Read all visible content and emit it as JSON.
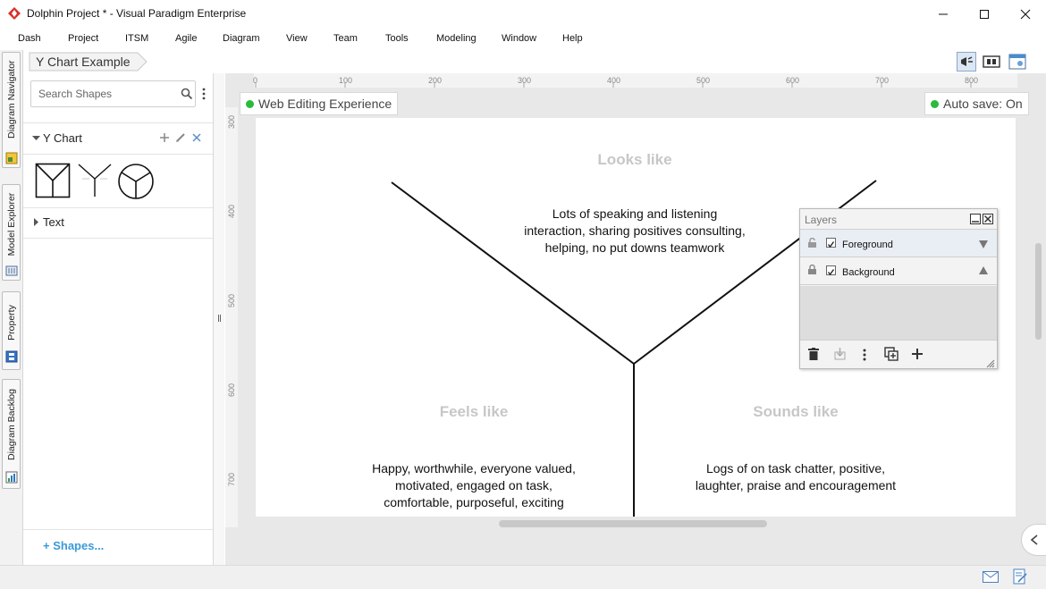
{
  "window": {
    "title": "Dolphin Project * - Visual Paradigm Enterprise",
    "icons": [
      "app-logo-icon",
      "minimize-icon",
      "maximize-icon",
      "close-icon"
    ]
  },
  "menu": [
    "Dash",
    "Project",
    "ITSM",
    "Agile",
    "Diagram",
    "View",
    "Team",
    "Tools",
    "Modeling",
    "Window",
    "Help"
  ],
  "left_tabs": [
    {
      "label": "Diagram Navigator",
      "icon": "diagram-navigator-icon"
    },
    {
      "label": "Model Explorer",
      "icon": "model-explorer-icon"
    },
    {
      "label": "Property",
      "icon": "property-icon"
    },
    {
      "label": "Diagram Backlog",
      "icon": "diagram-backlog-icon"
    }
  ],
  "breadcrumb": "Y Chart Example",
  "panel": {
    "search_placeholder": "Search Shapes",
    "group_label": "Y Chart",
    "text_group_label": "Text",
    "shapes_link": "Shapes..."
  },
  "toolbar_right_icons": [
    "announce-icon",
    "fit-diagram-icon",
    "diagram-settings-icon"
  ],
  "ruler": {
    "horizontal": [
      "0",
      "100",
      "200",
      "300",
      "400",
      "500",
      "600",
      "700",
      "800"
    ],
    "vertical": [
      "300",
      "400",
      "500",
      "600",
      "700"
    ]
  },
  "badges": {
    "web_editing": "Web Editing Experience",
    "autosave": "Auto save: On"
  },
  "diagram": {
    "looks_like": {
      "heading": "Looks like",
      "lines": [
        "Lots of speaking and listening",
        "interaction, sharing positives consulting,",
        "helping, no put downs teamwork"
      ]
    },
    "feels_like": {
      "heading": "Feels like",
      "lines": [
        "Happy, worthwhile, everyone valued,",
        "motivated, engaged on task,",
        "comfortable, purposeful, exciting"
      ]
    },
    "sounds_like": {
      "heading": "Sounds like",
      "lines": [
        "Logs of on task chatter, positive,",
        "laughter, praise and encouragement"
      ]
    }
  },
  "layers_panel": {
    "title": "Layers",
    "layers": [
      {
        "name": "Foreground",
        "visible": true,
        "locked": false
      },
      {
        "name": "Background",
        "visible": true,
        "locked": true
      }
    ]
  },
  "colors": {
    "accent_blue": "#3a9ad9",
    "status_green": "#2cba3b",
    "logo_red": "#d9302b"
  }
}
